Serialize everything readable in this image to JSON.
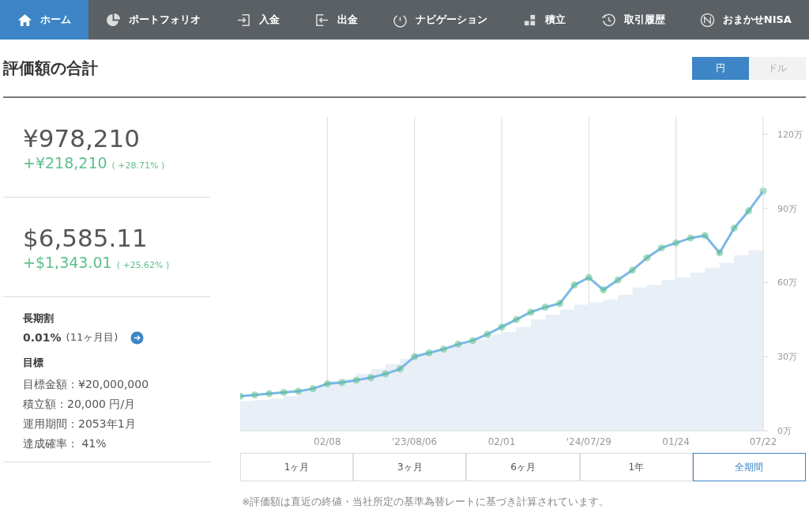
{
  "nav": [
    {
      "label": "ホーム",
      "selected": true
    },
    {
      "label": "ポートフォリオ",
      "selected": false
    },
    {
      "label": "入金",
      "selected": false
    },
    {
      "label": "出金",
      "selected": false
    },
    {
      "label": "ナビゲーション",
      "selected": false
    },
    {
      "label": "積立",
      "selected": false
    },
    {
      "label": "取引履歴",
      "selected": false
    },
    {
      "label": "おまかせNISA",
      "selected": false
    }
  ],
  "title": "評価額の合計",
  "currency": [
    {
      "label": "円",
      "selected": true
    },
    {
      "label": "ドル",
      "selected": false
    }
  ],
  "totals": [
    {
      "value": "¥978,210",
      "gain": "+¥218,210",
      "percent": "( +28.71% )"
    },
    {
      "value": "$6,585.11",
      "gain": "+$1,343.01",
      "percent": "( +25.62% )"
    }
  ],
  "discount": {
    "heading": "長期割",
    "rate": "0.01%",
    "months": "(11ヶ月目)"
  },
  "goal": {
    "heading": "目標",
    "lines": [
      "目標金額：¥20,000,000",
      "積立額：20,000 円/月",
      "運用期間：2053年1月",
      "達成確率： 41%"
    ]
  },
  "chart": {
    "chart_data": {
      "type": "line",
      "categories": [
        null,
        null,
        null,
        null,
        null,
        null,
        "02/08",
        null,
        null,
        null,
        null,
        null,
        "'23/08/06",
        null,
        null,
        null,
        null,
        null,
        "02/01",
        null,
        null,
        null,
        null,
        null,
        "'24/07/29",
        null,
        null,
        null,
        null,
        null,
        "01/24",
        null,
        null,
        null,
        null,
        null,
        "07/22"
      ],
      "grid": true,
      "series": [
        {
          "type": "line",
          "color": "#7ab8e8",
          "marker": "circle",
          "values": [
            14,
            14.5,
            15,
            15.5,
            16,
            17,
            19,
            19.5,
            20.5,
            21.5,
            23,
            25,
            30,
            31.5,
            33,
            35,
            36.5,
            39,
            42,
            45,
            48,
            50,
            51.5,
            59,
            62,
            57,
            61,
            65,
            70,
            74,
            76,
            78,
            79,
            72,
            82,
            89,
            97
          ]
        },
        {
          "type": "area",
          "color": "#e8eff7",
          "values": [
            12,
            12.5,
            13,
            14,
            16,
            18,
            20,
            21,
            23,
            25,
            27,
            29,
            31,
            32,
            34,
            36,
            37,
            39,
            40,
            42,
            45,
            47,
            49,
            51,
            52,
            53,
            55,
            58,
            59,
            61,
            62,
            64,
            66,
            68,
            71,
            73,
            76
          ]
        }
      ],
      "ylim": [
        0,
        127
      ],
      "yticks": [
        {
          "value": 0,
          "label": "0万"
        },
        {
          "value": 30,
          "label": "30万"
        },
        {
          "value": 60,
          "label": "60万"
        },
        {
          "value": 90,
          "label": "90万"
        },
        {
          "value": 120,
          "label": "120万"
        }
      ]
    }
  },
  "periods": [
    {
      "label": "1ヶ月",
      "selected": false
    },
    {
      "label": "3ヶ月",
      "selected": false
    },
    {
      "label": "6ヶ月",
      "selected": false
    },
    {
      "label": "1年",
      "selected": false
    },
    {
      "label": "全期間",
      "selected": true
    }
  ],
  "footnote": "※評価額は直近の終値・当社所定の基準為替レートに基づき計算されています。"
}
